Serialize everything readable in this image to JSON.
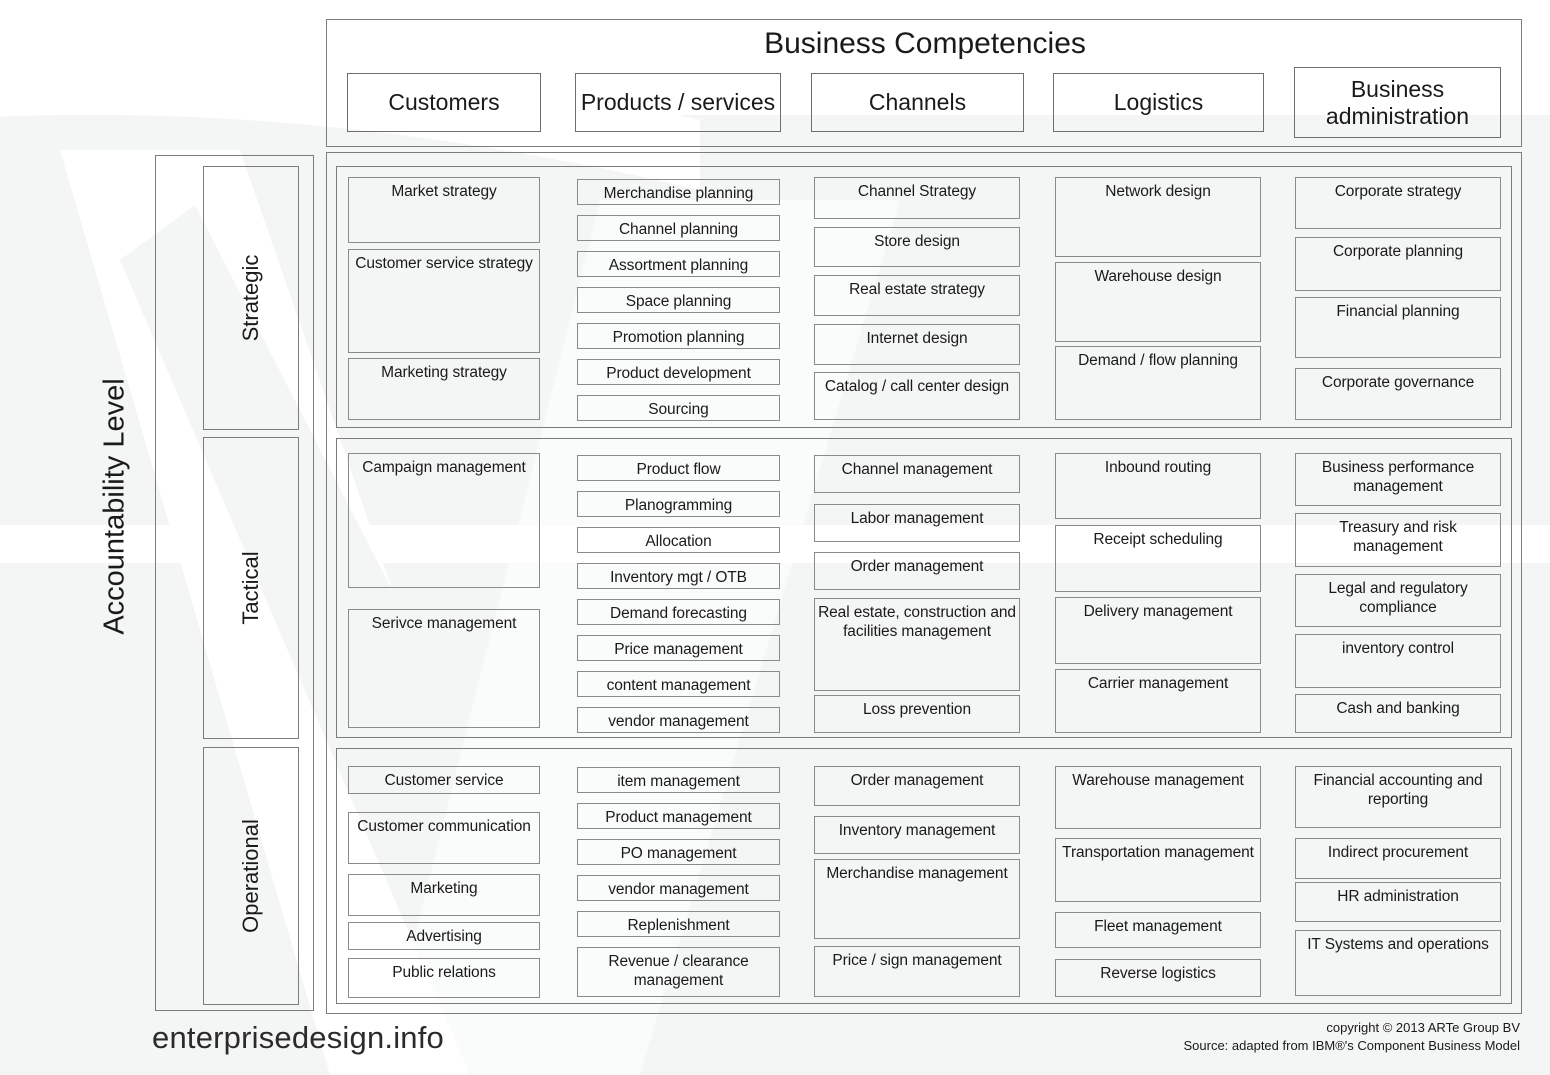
{
  "header": {
    "title": "Business Competencies",
    "columns": [
      {
        "label": "Customers"
      },
      {
        "label": "Products / services"
      },
      {
        "label": "Channels"
      },
      {
        "label": "Logistics"
      },
      {
        "label": "Business administration"
      }
    ]
  },
  "axis": {
    "title": "Accountability Level",
    "levels": [
      "Strategic",
      "Tactical",
      "Operational"
    ]
  },
  "matrix": {
    "strategic": {
      "customers": [
        "Market strategy",
        "Customer service strategy",
        "Marketing strategy"
      ],
      "products": [
        "Merchandise planning",
        "Channel planning",
        "Assortment planning",
        "Space planning",
        "Promotion planning",
        "Product development",
        "Sourcing"
      ],
      "channels": [
        "Channel Strategy",
        "Store design",
        "Real estate strategy",
        "Internet design",
        "Catalog / call center design"
      ],
      "logistics": [
        "Network design",
        "Warehouse design",
        "Demand / flow planning"
      ],
      "administration": [
        "Corporate strategy",
        "Corporate planning",
        "Financial planning",
        "Corporate governance"
      ]
    },
    "tactical": {
      "customers": [
        "Campaign management",
        "Serivce management"
      ],
      "products": [
        "Product flow",
        "Planogramming",
        "Allocation",
        "Inventory mgt / OTB",
        "Demand forecasting",
        "Price management",
        "content management",
        "vendor management"
      ],
      "channels": [
        "Channel management",
        "Labor management",
        "Order management",
        "Real estate, construction and facilities management",
        "Loss prevention"
      ],
      "logistics": [
        "Inbound routing",
        "Receipt scheduling",
        "Delivery management",
        "Carrier management"
      ],
      "administration": [
        "Business performance management",
        "Treasury and risk management",
        "Legal and regulatory compliance",
        "inventory control",
        "Cash and banking"
      ]
    },
    "operational": {
      "customers": [
        "Customer service",
        "Customer communication",
        "Marketing",
        "Advertising",
        "Public relations"
      ],
      "products": [
        "item management",
        "Product management",
        "PO management",
        "vendor management",
        "Replenishment",
        "Revenue / clearance management"
      ],
      "channels": [
        "Order management",
        "Inventory management",
        "Merchandise management",
        "Price / sign management"
      ],
      "logistics": [
        "Warehouse management",
        "Transportation management",
        "Fleet management",
        "Reverse logistics"
      ],
      "administration": [
        "Financial accounting and reporting",
        "Indirect procurement",
        "HR administration",
        "IT Systems and operations"
      ]
    }
  },
  "footer": {
    "brand": "enterprisedesign.info",
    "copyright_line1": "copyright © 2013 ARTe Group BV",
    "copyright_line2": "Source: adapted from IBM®'s Component Business Model"
  },
  "colors": {
    "border": "#7c7c7c",
    "cell_border": "#8a8a8a",
    "text": "#1a1a1a",
    "watermark": "#f2f3f3"
  }
}
